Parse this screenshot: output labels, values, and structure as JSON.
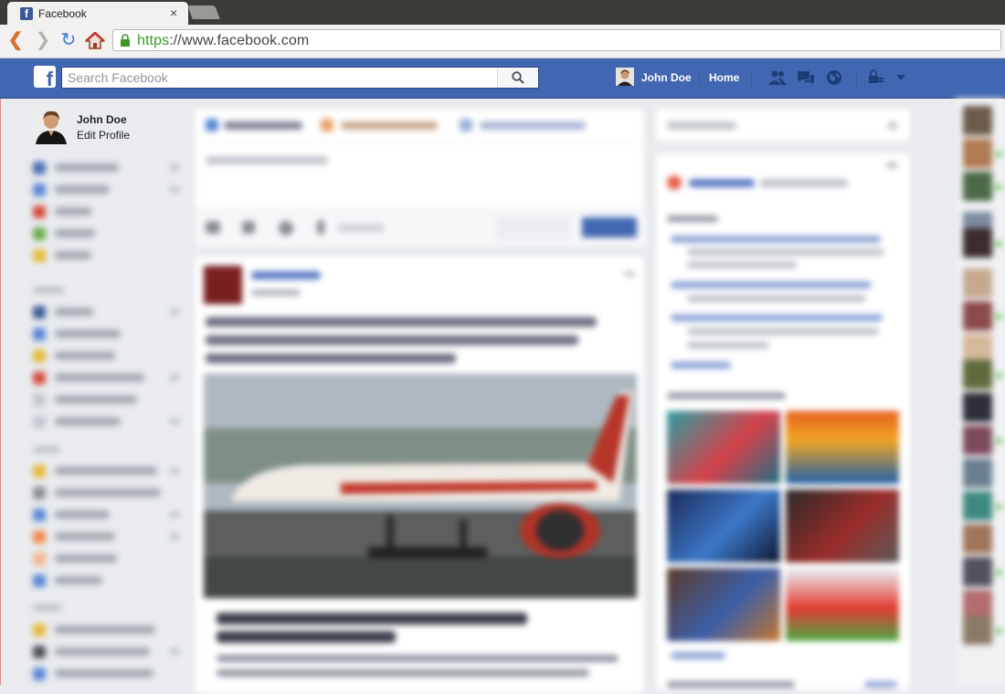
{
  "browser": {
    "tab_title": "Facebook",
    "tab_close": "×",
    "url_scheme": "https",
    "url_rest": "://www.facebook.com"
  },
  "header": {
    "logo": "f",
    "search_placeholder": "Search Facebook",
    "user_name": "John Doe",
    "home_label": "Home"
  },
  "sidebar": {
    "profile_name": "John Doe",
    "edit_profile_label": "Edit Profile"
  },
  "colors": {
    "brand_blue": "#4267b2",
    "page_bg": "#e9ebee",
    "secure_green": "#3a9a24"
  },
  "icons": [
    "back-icon",
    "forward-icon",
    "reload-icon",
    "home-icon",
    "lock-icon",
    "search-icon",
    "friend-requests-icon",
    "messages-icon",
    "notifications-icon",
    "privacy-icon"
  ]
}
